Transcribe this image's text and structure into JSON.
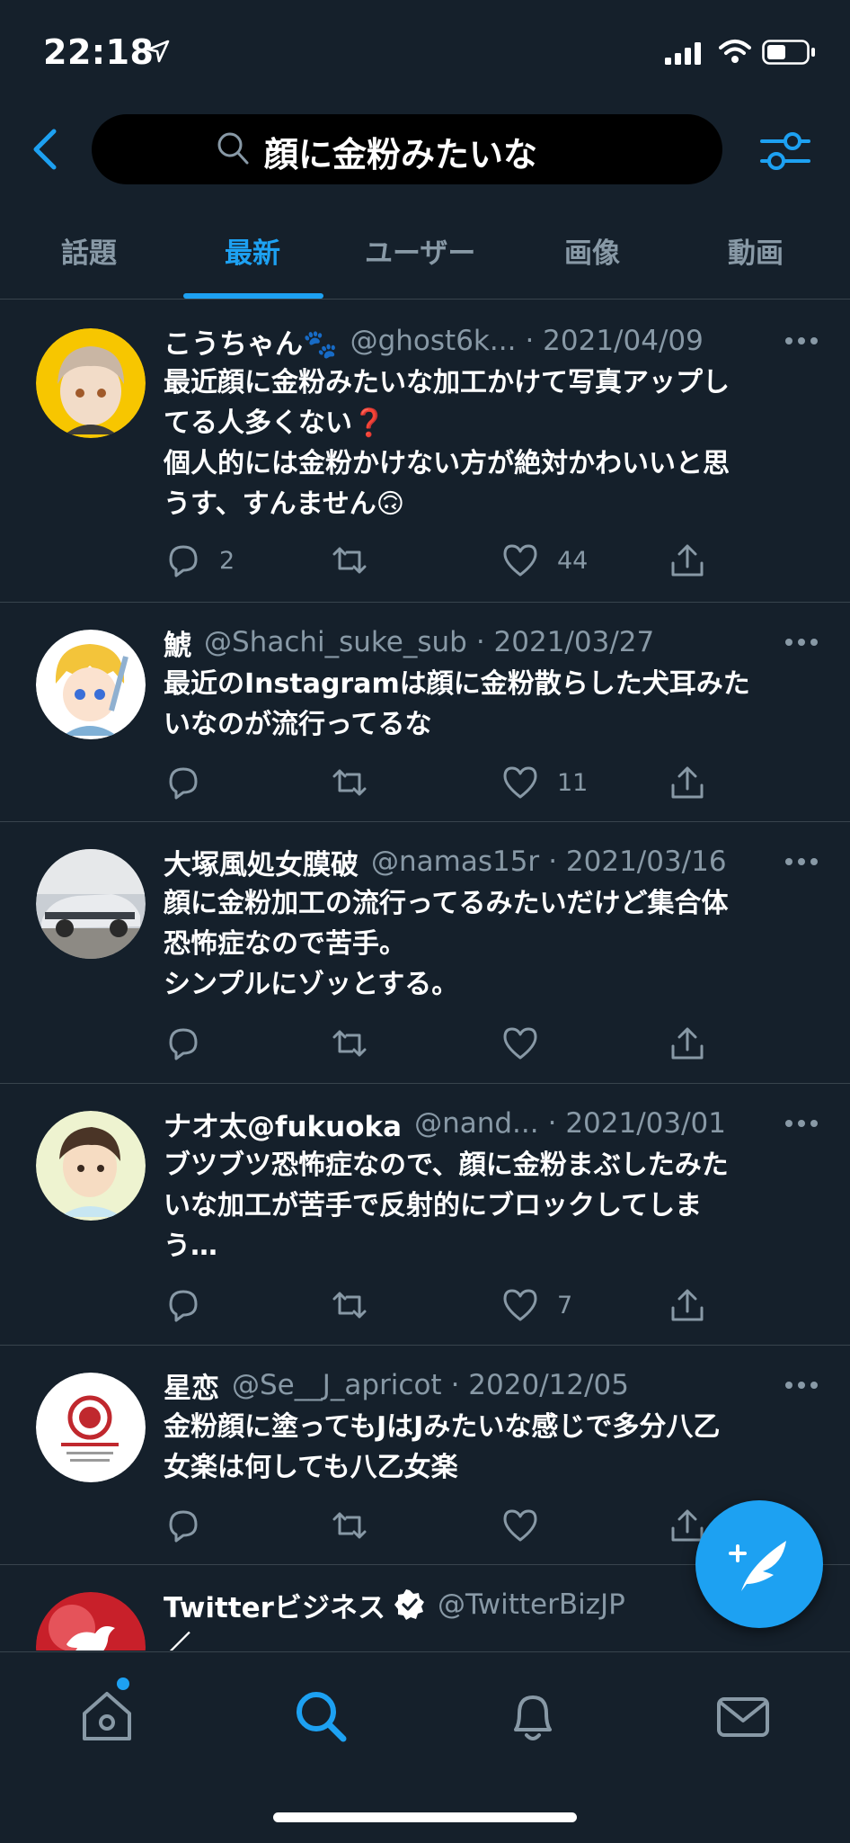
{
  "status_bar": {
    "time": "22:18"
  },
  "search": {
    "query": "顔に金粉みたいな"
  },
  "tabs": [
    {
      "label": "話題"
    },
    {
      "label": "最新"
    },
    {
      "label": "ユーザー"
    },
    {
      "label": "画像"
    },
    {
      "label": "動画"
    }
  ],
  "tweets": [
    {
      "name": "こうちゃん🐾",
      "handle": "@ghost6k...",
      "date": "· 2021/04/09",
      "lines": [
        "最近顔に金粉みたいな加工かけて写真アップし",
        "てる人多くない❓",
        "個人的には金粉かけない方が絶対かわいいと思",
        "うす、すんません🙃"
      ],
      "replies": "2",
      "retweets": "",
      "likes": "44"
    },
    {
      "name": "鯱",
      "handle": "@Shachi_suke_sub",
      "date": "· 2021/03/27",
      "lines": [
        "最近のInstagramは顔に金粉散らした犬耳みた",
        "いなのが流行ってるな"
      ],
      "replies": "",
      "retweets": "",
      "likes": "11"
    },
    {
      "name": "大塚風処女膜破",
      "handle": "@namas15r",
      "date": "· 2021/03/16",
      "lines": [
        "顔に金粉加工の流行ってるみたいだけど集合体",
        "恐怖症なので苦手。",
        "シンプルにゾッとする。"
      ],
      "replies": "",
      "retweets": "",
      "likes": ""
    },
    {
      "name": "ナオ太@fukuoka",
      "handle": "@nand...",
      "date": "· 2021/03/01",
      "lines": [
        "ブツブツ恐怖症なので、顔に金粉まぶしたみた",
        "いな加工が苦手で反射的にブロックしてしま",
        "う…"
      ],
      "replies": "",
      "retweets": "",
      "likes": "7"
    },
    {
      "name": "星恋",
      "handle": "@Se__J_apricot",
      "date": "· 2020/12/05",
      "lines": [
        "金粉顔に塗ってもJはJみたいな感じで多分八乙",
        "女楽は何しても八乙女楽"
      ],
      "replies": "",
      "retweets": "",
      "likes": ""
    },
    {
      "name": "Twitterビジネス",
      "handle": "@TwitterBizJP",
      "date": "",
      "lines": [
        "／"
      ],
      "replies": "",
      "retweets": "",
      "likes": ""
    }
  ],
  "colors": {
    "background": "#15202b",
    "accent": "#1da1f2",
    "secondary_text": "#8899a6",
    "divider": "#38444d"
  }
}
